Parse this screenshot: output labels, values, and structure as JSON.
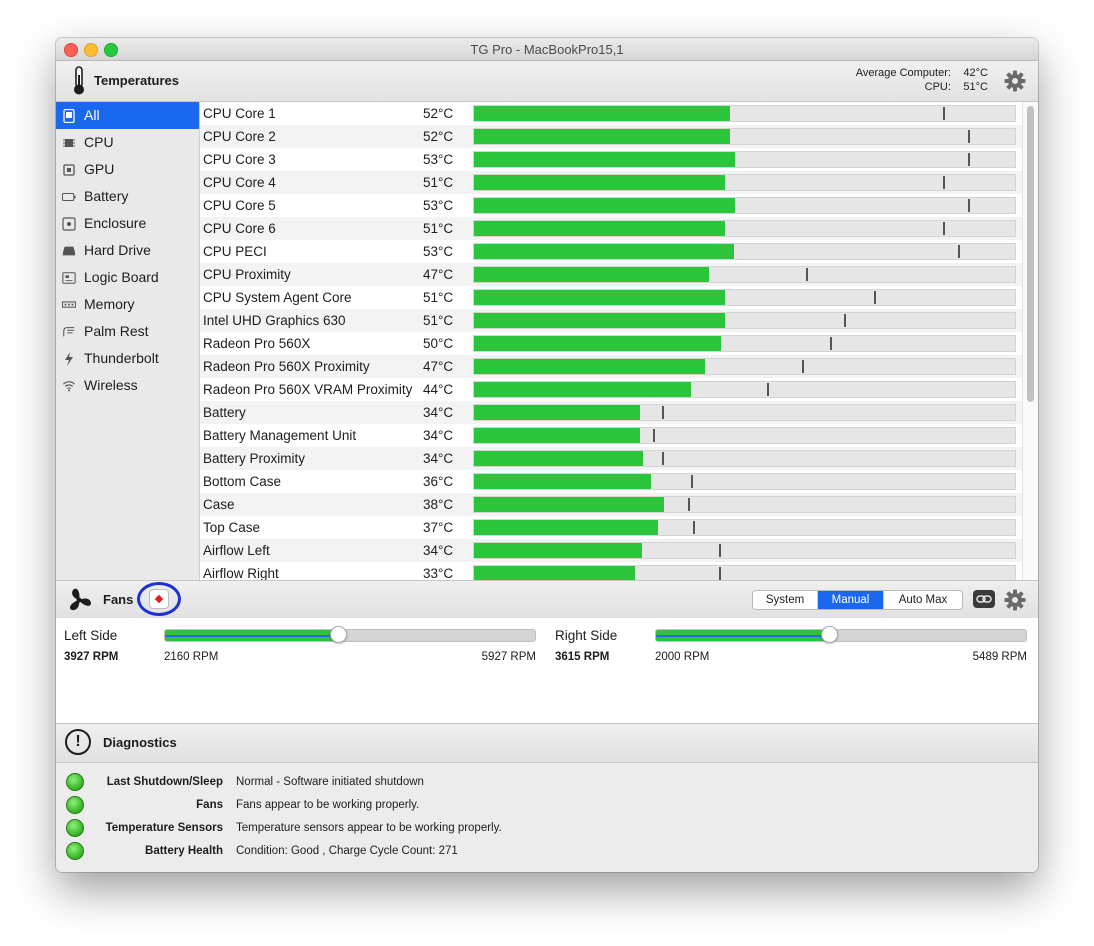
{
  "window": {
    "title": "TG Pro - MacBookPro15,1"
  },
  "temperatures": {
    "title": "Temperatures",
    "average_label": "Average Computer:",
    "average_value": "42°C",
    "cpu_label": "CPU:",
    "cpu_value": "51°C"
  },
  "sidebar": {
    "items": [
      {
        "label": "All",
        "icon": "laptop-icon",
        "selected": true
      },
      {
        "label": "CPU",
        "icon": "cpu-chip-icon",
        "selected": false
      },
      {
        "label": "GPU",
        "icon": "gpu-chip-icon",
        "selected": false
      },
      {
        "label": "Battery",
        "icon": "battery-icon",
        "selected": false
      },
      {
        "label": "Enclosure",
        "icon": "enclosure-icon",
        "selected": false
      },
      {
        "label": "Hard Drive",
        "icon": "hard-drive-icon",
        "selected": false
      },
      {
        "label": "Logic Board",
        "icon": "logic-board-icon",
        "selected": false
      },
      {
        "label": "Memory",
        "icon": "memory-icon",
        "selected": false
      },
      {
        "label": "Palm Rest",
        "icon": "palm-rest-icon",
        "selected": false
      },
      {
        "label": "Thunderbolt",
        "icon": "thunderbolt-icon",
        "selected": false
      },
      {
        "label": "Wireless",
        "icon": "wifi-icon",
        "selected": false
      }
    ]
  },
  "sensors": [
    {
      "name": "CPU Core 1",
      "value": "52°C",
      "fill": 0.472,
      "mark": 0.863
    },
    {
      "name": "CPU Core 2",
      "value": "52°C",
      "fill": 0.472,
      "mark": 0.909
    },
    {
      "name": "CPU Core 3",
      "value": "53°C",
      "fill": 0.481,
      "mark": 0.909
    },
    {
      "name": "CPU Core 4",
      "value": "51°C",
      "fill": 0.463,
      "mark": 0.863
    },
    {
      "name": "CPU Core 5",
      "value": "53°C",
      "fill": 0.481,
      "mark": 0.909
    },
    {
      "name": "CPU Core 6",
      "value": "51°C",
      "fill": 0.463,
      "mark": 0.863
    },
    {
      "name": "CPU PECI",
      "value": "53°C",
      "fill": 0.478,
      "mark": 0.891
    },
    {
      "name": "CPU Proximity",
      "value": "47°C",
      "fill": 0.432,
      "mark": 0.612
    },
    {
      "name": "CPU System Agent Core",
      "value": "51°C",
      "fill": 0.463,
      "mark": 0.737
    },
    {
      "name": "Intel UHD Graphics 630",
      "value": "51°C",
      "fill": 0.463,
      "mark": 0.682
    },
    {
      "name": "Radeon Pro 560X",
      "value": "50°C",
      "fill": 0.454,
      "mark": 0.656
    },
    {
      "name": "Radeon Pro 560X Proximity",
      "value": "47°C",
      "fill": 0.426,
      "mark": 0.604
    },
    {
      "name": "Radeon Pro 560X VRAM Proximity",
      "value": "44°C",
      "fill": 0.4,
      "mark": 0.54
    },
    {
      "name": "Battery",
      "value": "34°C",
      "fill": 0.306,
      "mark": 0.346
    },
    {
      "name": "Battery Management Unit",
      "value": "34°C",
      "fill": 0.306,
      "mark": 0.33
    },
    {
      "name": "Battery Proximity",
      "value": "34°C",
      "fill": 0.311,
      "mark": 0.346
    },
    {
      "name": "Bottom Case",
      "value": "36°C",
      "fill": 0.326,
      "mark": 0.4
    },
    {
      "name": "Case",
      "value": "38°C",
      "fill": 0.35,
      "mark": 0.394
    },
    {
      "name": "Top Case",
      "value": "37°C",
      "fill": 0.339,
      "mark": 0.403
    },
    {
      "name": "Airflow Left",
      "value": "34°C",
      "fill": 0.309,
      "mark": 0.451
    },
    {
      "name": "Airflow Right",
      "value": "33°C",
      "fill": 0.297,
      "mark": 0.451
    }
  ],
  "fans": {
    "title": "Fans",
    "modes": [
      "System",
      "Manual",
      "Auto Max"
    ],
    "active_mode": "Manual",
    "left": {
      "label": "Left Side",
      "rpm": "3927 RPM",
      "min": "2160 RPM",
      "max": "5927 RPM",
      "level": 0.465
    },
    "right": {
      "label": "Right Side",
      "rpm": "3615 RPM",
      "min": "2000 RPM",
      "max": "5489 RPM",
      "level": 0.465
    }
  },
  "diagnostics": {
    "title": "Diagnostics",
    "rows": [
      {
        "label": "Last Shutdown/Sleep",
        "value": "Normal - Software initiated shutdown"
      },
      {
        "label": "Fans",
        "value": "Fans appear to be working properly."
      },
      {
        "label": "Temperature Sensors",
        "value": "Temperature sensors appear to be working properly."
      },
      {
        "label": "Battery Health",
        "value": "Condition: Good , Charge Cycle Count: 271"
      }
    ]
  },
  "colors": {
    "accent": "#1a68ee",
    "bar": "#2cc43b",
    "highlight_ring": "#1d2fd6",
    "warning": "#e51c1c"
  }
}
